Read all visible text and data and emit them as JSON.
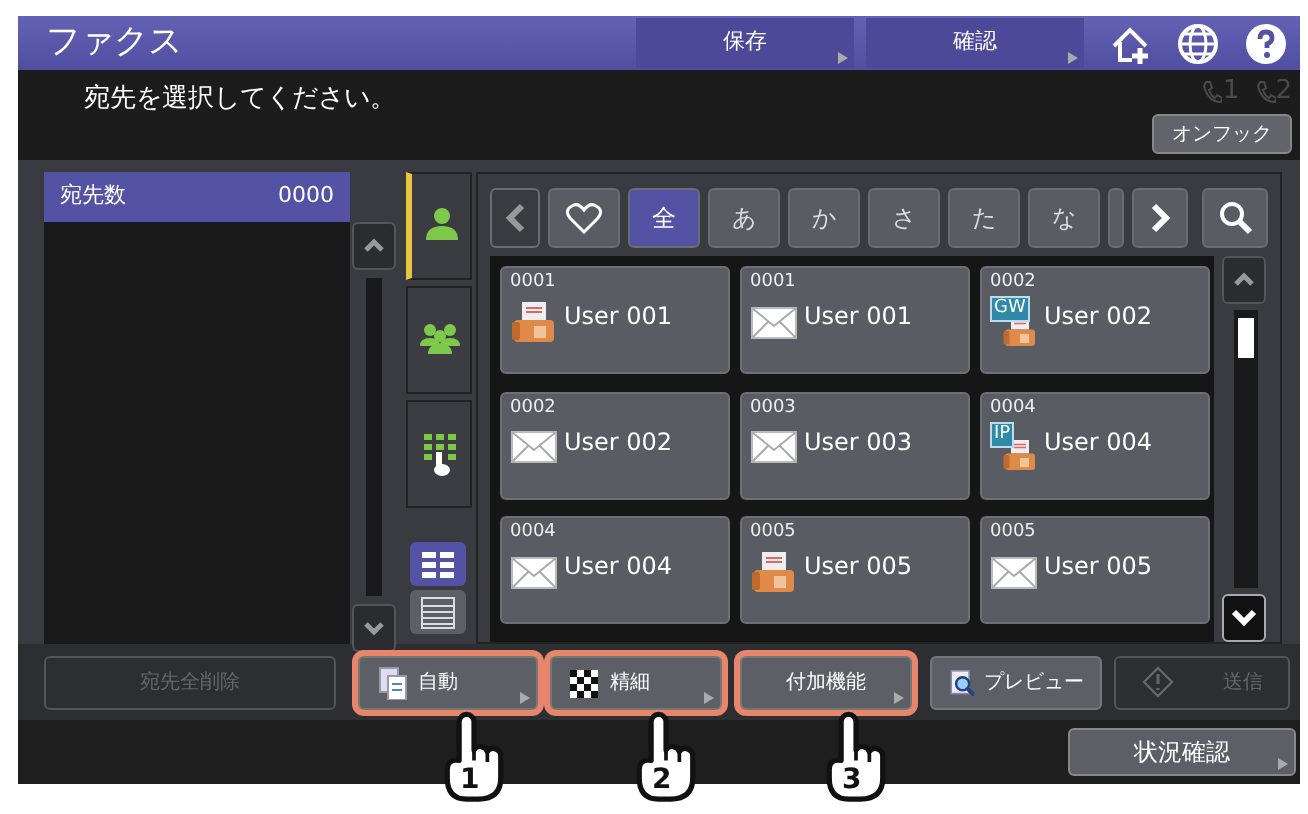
{
  "header": {
    "title": "ファクス",
    "buttons": [
      {
        "label": "保存",
        "menu": true
      },
      {
        "label": "確認",
        "menu": true
      }
    ]
  },
  "message": "宛先を選択してください。",
  "lines": [
    {
      "label": "1",
      "disabled": true
    },
    {
      "label": "2",
      "disabled": true
    }
  ],
  "onhook": "オンフック",
  "recipients": {
    "label": "宛先数",
    "count": "0000"
  },
  "source_tabs": [
    {
      "kind": "person",
      "selected": true
    },
    {
      "kind": "group",
      "selected": false
    },
    {
      "kind": "keypad",
      "selected": false
    }
  ],
  "views": [
    {
      "kind": "grid",
      "selected": true
    },
    {
      "kind": "list",
      "selected": false
    }
  ],
  "index_tabs": [
    {
      "kind": "favorite",
      "selected": false
    },
    {
      "kind": "text",
      "label": "全",
      "selected": true
    },
    {
      "kind": "text",
      "label": "あ",
      "selected": false
    },
    {
      "kind": "text",
      "label": "か",
      "selected": false
    },
    {
      "kind": "text",
      "label": "さ",
      "selected": false
    },
    {
      "kind": "text",
      "label": "た",
      "selected": false
    },
    {
      "kind": "text",
      "label": "な",
      "selected": false
    },
    {
      "kind": "cut",
      "selected": false
    }
  ],
  "cards": [
    {
      "code": "0001",
      "name": "User 001",
      "kind": "fax"
    },
    {
      "code": "0001",
      "name": "User 001",
      "kind": "email"
    },
    {
      "code": "0002",
      "name": "User 002",
      "kind": "fax",
      "badge": "GW"
    },
    {
      "code": "0002",
      "name": "User 002",
      "kind": "email"
    },
    {
      "code": "0003",
      "name": "User 003",
      "kind": "email"
    },
    {
      "code": "0004",
      "name": "User 004",
      "kind": "fax",
      "badge": "IP"
    },
    {
      "code": "0004",
      "name": "User 004",
      "kind": "email"
    },
    {
      "code": "0005",
      "name": "User 005",
      "kind": "fax"
    },
    {
      "code": "0005",
      "name": "User 005",
      "kind": "email"
    }
  ],
  "actions": [
    {
      "label": "宛先全削除",
      "kind": "plain",
      "disabled": true,
      "menu": false,
      "highlighted": false
    },
    {
      "label": "自動",
      "kind": "original-mode",
      "disabled": false,
      "menu": true,
      "highlighted": true,
      "step": "1"
    },
    {
      "label": "精細",
      "kind": "resolution",
      "disabled": false,
      "menu": true,
      "highlighted": true,
      "step": "2"
    },
    {
      "label": "付加機能",
      "kind": "plain",
      "disabled": false,
      "menu": true,
      "highlighted": true,
      "step": "3"
    },
    {
      "label": "プレビュー",
      "kind": "preview",
      "disabled": false,
      "menu": false,
      "highlighted": false
    },
    {
      "label": "送信",
      "kind": "send",
      "disabled": true,
      "menu": false,
      "highlighted": false
    }
  ],
  "status_button": {
    "label": "状況確認",
    "menu": true
  }
}
